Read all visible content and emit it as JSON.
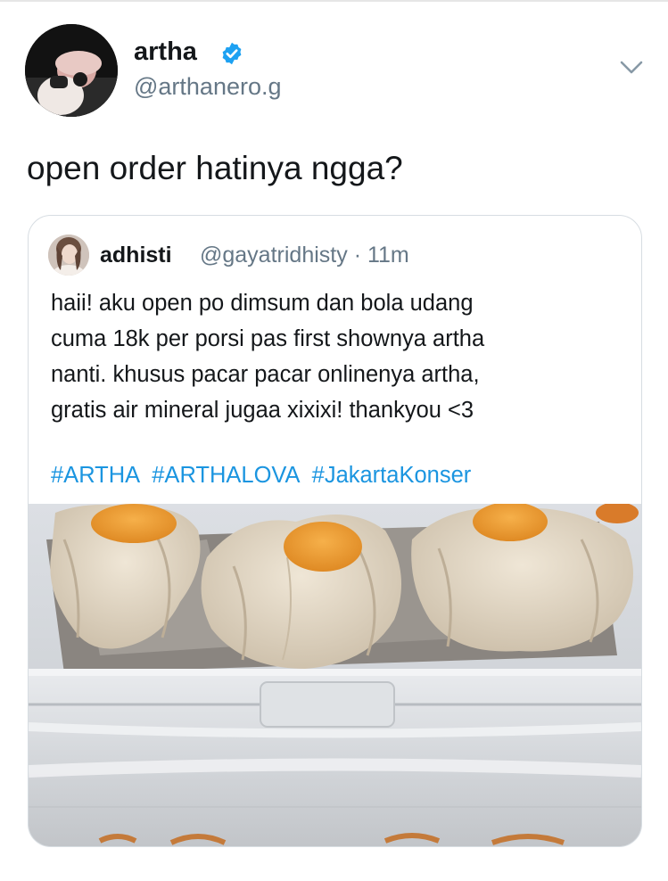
{
  "tweet": {
    "author": {
      "display_name": "artha",
      "handle": "@arthanero.g",
      "verified": true
    },
    "text": "open order hatinya ngga?"
  },
  "quoted_tweet": {
    "author": {
      "display_name": "adhisti",
      "handle": "@gayatridhisty",
      "separator": "·",
      "time": "11m"
    },
    "text_lines": [
      "haii! aku open po dimsum dan bola udang",
      "cuma 18k per porsi pas first shownya artha",
      "nanti. khusus pacar pacar onlinenya artha,",
      "gratis air mineral jugaa xixixi! thankyou <3"
    ],
    "hashtags": [
      "#ARTHA",
      "#ARTHALOVA",
      "#JakartaKonser"
    ],
    "media": {
      "subject": "dimsum-photo"
    }
  },
  "icons": [
    "verified-badge-icon",
    "chevron-down-icon"
  ],
  "colors": {
    "link": "#1b95e0",
    "verified": "#1da1f2",
    "secondary_text": "#657786"
  }
}
